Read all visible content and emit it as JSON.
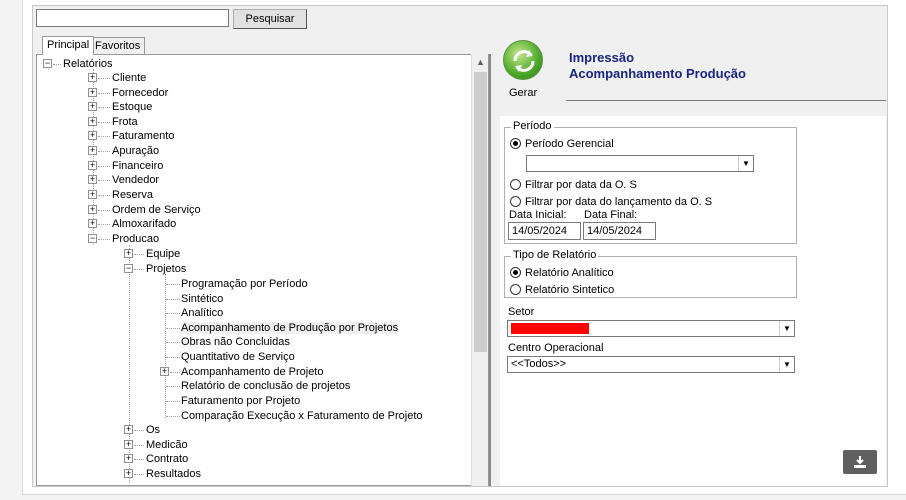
{
  "search": {
    "value": "",
    "button_label": "Pesquisar"
  },
  "tabs": [
    {
      "label": "Principal"
    },
    {
      "label": "Favoritos"
    }
  ],
  "tree": {
    "root": "Relatórios",
    "level1": [
      "Cliente",
      "Fornecedor",
      "Estoque",
      "Frota",
      "Faturamento",
      "Apuração",
      "Financeiro",
      "Vendedor",
      "Reserva",
      "Ordem de Serviço",
      "Almoxarifado",
      "Producao"
    ],
    "producao_children": [
      "Equipe",
      "Projetos"
    ],
    "projetos_children": [
      "Programação por Período",
      "Sintético",
      "Analítico",
      "Acompanhamento de Produção por Projetos",
      "Obras não Concluidas",
      "Quantitativo de Serviço",
      "Acompanhamento de Projeto",
      "Relatório de conclusão de projetos",
      "Faturamento por Projeto",
      "Comparação Execução x Faturamento de Projeto"
    ],
    "producao_more": [
      "Os",
      "Medicão",
      "Contrato",
      "Resultados"
    ]
  },
  "header": {
    "gerar_label": "Gerar",
    "title_line1": "Impressão",
    "title_line2": "Acompanhamento Produção"
  },
  "periodo": {
    "title": "Período",
    "gerencial_label": "Período Gerencial",
    "gerencial_value": "",
    "filtro_os_label": "Filtrar por data da O. S",
    "filtro_lanc_label": "Filtrar por data do lançamento da O. S",
    "data_inicial_label": "Data Inicial:",
    "data_final_label": "Data Final:",
    "data_inicial": "14/05/2024",
    "data_final": "14/05/2024"
  },
  "tipo": {
    "title": "Tipo de Relatório",
    "analitico_label": "Relatório Analítico",
    "sintetico_label": "Relatório Sintetico"
  },
  "setor": {
    "label": "Setor"
  },
  "centro": {
    "label": "Centro Operacional",
    "value": "<<Todos>>"
  },
  "colors": {
    "title": "#1a237e",
    "redacted": "#ff0000",
    "download_bg": "#606060"
  }
}
